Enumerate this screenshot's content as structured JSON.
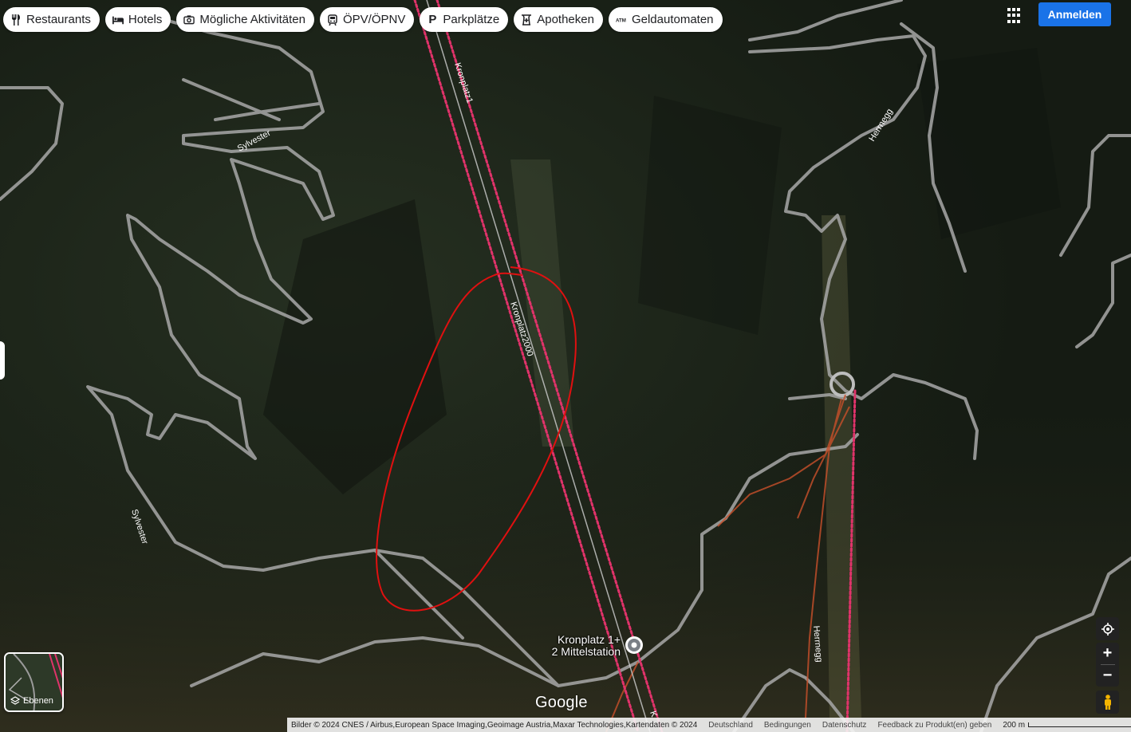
{
  "chips": [
    {
      "label": "Restaurants",
      "icon": "fork-knife-icon"
    },
    {
      "label": "Hotels",
      "icon": "bed-icon"
    },
    {
      "label": "Mögliche Aktivitäten",
      "icon": "camera-icon"
    },
    {
      "label": "ÖPV/ÖPNV",
      "icon": "train-icon"
    },
    {
      "label": "Parkplätze",
      "icon": "parking-icon"
    },
    {
      "label": "Apotheken",
      "icon": "pharmacy-icon"
    },
    {
      "label": "Geldautomaten",
      "icon": "atm-icon"
    }
  ],
  "header": {
    "signin_label": "Anmelden",
    "apps_icon": "apps-grid-icon"
  },
  "map_labels": {
    "lift_1": "Kronplatz1",
    "lift_2": "Kronplatz2000",
    "lift_3": "K",
    "road_a": "Sylvester",
    "road_b": "Sylvester",
    "road_c": "Herrnegg",
    "road_d": "Herrnegg"
  },
  "place": {
    "line1": "Kronplatz 1+",
    "line2": "2 Mittelstation"
  },
  "layers_label": "Ebenen",
  "logo": "Google",
  "footer": {
    "attribution": "Bilder © 2024 CNES / Airbus,European Space Imaging,Geoimage Austria,Maxar Technologies,Kartendaten © 2024",
    "country": "Deutschland",
    "terms": "Bedingungen",
    "privacy": "Datenschutz",
    "feedback": "Feedback zu Produkt(en) geben",
    "scale": "200 m"
  },
  "colors": {
    "accent": "#1a73e8",
    "lift": "#e0336a",
    "annotation": "#e01010",
    "road": "#a8a8a8",
    "trail": "#c9502a"
  }
}
